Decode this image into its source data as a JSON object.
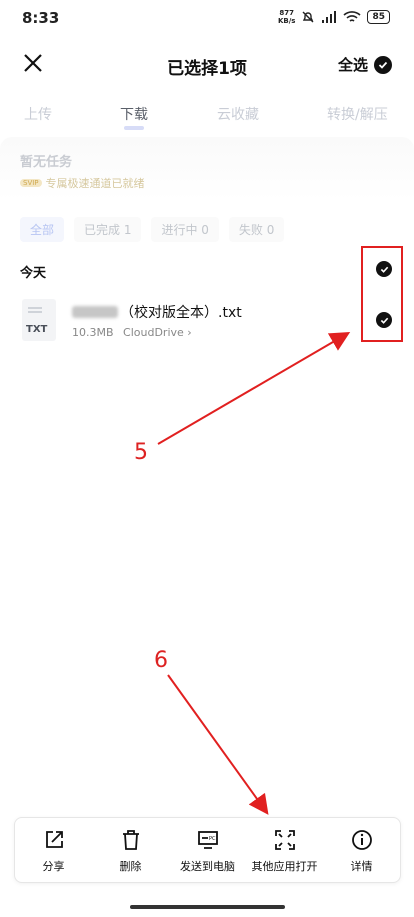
{
  "status_bar": {
    "time": "8:33",
    "net_speed_value": "877",
    "net_speed_unit": "KB/s",
    "battery": "85"
  },
  "header": {
    "title": "已选择1项",
    "select_all": "全选"
  },
  "tabs": [
    {
      "label": "上传",
      "active": false
    },
    {
      "label": "下载",
      "active": true
    },
    {
      "label": "云收藏",
      "active": false
    },
    {
      "label": "转换/解压",
      "active": false
    }
  ],
  "task_card": {
    "title": "暂无任务",
    "badge": "SVIP",
    "subtitle": "专属极速通道已就绪"
  },
  "filters": [
    {
      "label": "全部",
      "active": true
    },
    {
      "label": "已完成 1",
      "active": false
    },
    {
      "label": "进行中 0",
      "active": false
    },
    {
      "label": "失败 0",
      "active": false
    }
  ],
  "section": {
    "label": "今天"
  },
  "file": {
    "icon_ext": "TXT",
    "name": "（校对版全本）.txt",
    "size": "10.3MB",
    "location": "CloudDrive",
    "chevron": "›"
  },
  "annotations": {
    "label_5": "5",
    "label_6": "6",
    "color": "#e12020"
  },
  "actions": [
    {
      "label": "分享",
      "icon": "share-icon"
    },
    {
      "label": "删除",
      "icon": "trash-icon"
    },
    {
      "label": "发送到电脑",
      "icon": "send-to-pc-icon"
    },
    {
      "label": "其他应用打开",
      "icon": "open-with-icon"
    },
    {
      "label": "详情",
      "icon": "info-icon"
    }
  ]
}
